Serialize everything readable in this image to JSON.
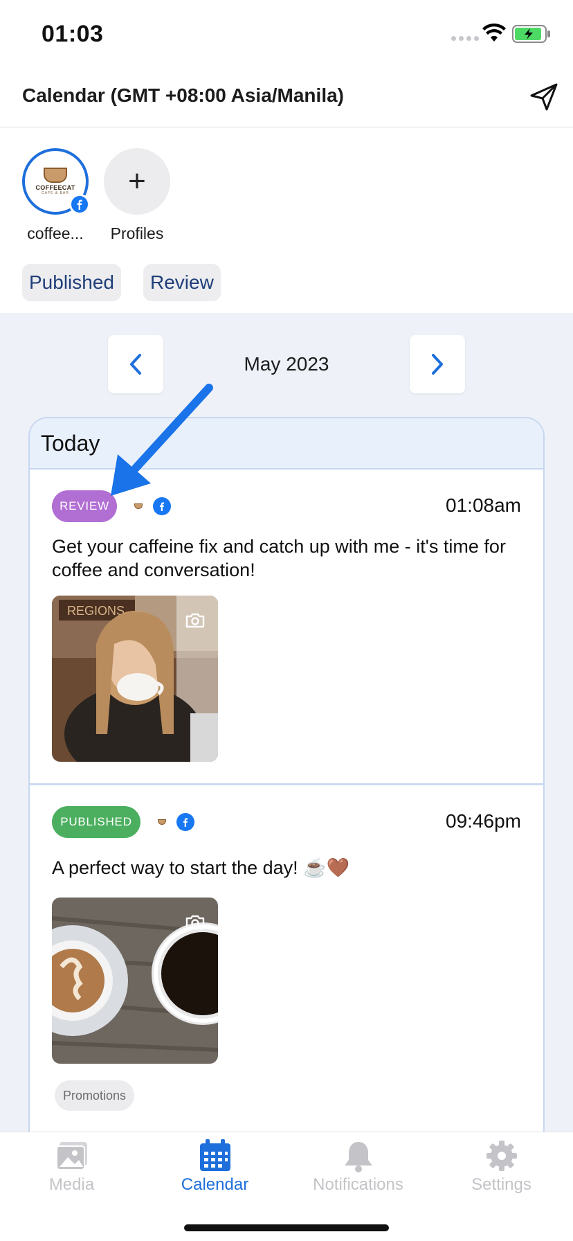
{
  "status_bar": {
    "time": "01:03"
  },
  "header": {
    "title": "Calendar (GMT +08:00 Asia/Manila)",
    "send_icon": "send-icon"
  },
  "profiles": [
    {
      "label": "coffee...",
      "logo_text": "COFFEECAT",
      "logo_sub": "CAFE & BAR",
      "network": "facebook"
    },
    {
      "label": "Profiles",
      "symbol": "+"
    }
  ],
  "filters": [
    "Published",
    "Review"
  ],
  "calendar": {
    "month": "May 2023",
    "section_title": "Today"
  },
  "posts": [
    {
      "status": "REVIEW",
      "status_color": "#b16ed3",
      "time": "01:08am",
      "text": "Get your caffeine fix and catch up with me - it's time for coffee and conversation!",
      "image_icon": "camera-icon"
    },
    {
      "status": "PUBLISHED",
      "status_color": "#4caf60",
      "time": "09:46pm",
      "text": "A perfect way to start the day! ☕️🤎",
      "image_icon": "camera-icon",
      "tag": "Promotions"
    }
  ],
  "tabs": [
    {
      "label": "Media",
      "icon": "image-icon",
      "active": false
    },
    {
      "label": "Calendar",
      "icon": "calendar-icon",
      "active": true
    },
    {
      "label": "Notifications",
      "icon": "bell-icon",
      "active": false
    },
    {
      "label": "Settings",
      "icon": "gear-icon",
      "active": false
    }
  ],
  "colors": {
    "accent": "#1e6fdb",
    "facebook": "#1877f2",
    "annotation_arrow": "#1a73e8"
  }
}
